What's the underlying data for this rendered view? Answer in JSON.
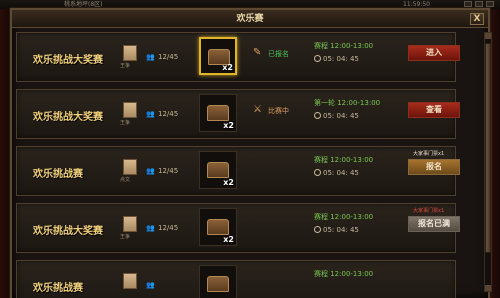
{
  "topbar": {
    "left_text": "桃系地坪(8区)",
    "right_text": "11:59:50"
  },
  "window": {
    "title": "欢乐赛",
    "close_label": "X"
  },
  "events": [
    {
      "name": "欢乐挑战大奖赛",
      "tag": "王争",
      "players": "12/45",
      "reward_qty": "x2",
      "highlighted": true,
      "status": "已报名",
      "time_label": "赛程 12:00-13:00",
      "countdown": "05: 04: 45",
      "note": "",
      "button": "进入",
      "button_style": "red"
    },
    {
      "name": "欢乐挑战大奖赛",
      "tag": "王争",
      "players": "12/45",
      "reward_qty": "x2",
      "highlighted": false,
      "status": "比赛中",
      "time_label": "第一轮 12:00-13:00",
      "countdown": "05: 04: 45",
      "note": "",
      "button": "查看",
      "button_style": "red"
    },
    {
      "name": "欢乐挑战赛",
      "tag": "点文",
      "players": "12/45",
      "reward_qty": "x2",
      "highlighted": false,
      "status": "",
      "time_label": "赛程 12:00-13:00",
      "countdown": "05: 04: 45",
      "note": "大家事门票x1",
      "button": "报名",
      "button_style": "gold"
    },
    {
      "name": "欢乐挑战大奖赛",
      "tag": "王争",
      "players": "12/45",
      "reward_qty": "x2",
      "highlighted": false,
      "status": "",
      "time_label": "赛程 12:00-13:00",
      "countdown": "05: 04: 45",
      "note": "大家事门票x1",
      "button": "报名已满",
      "button_style": "gray"
    },
    {
      "name": "欢乐挑战赛",
      "tag": "",
      "players": "",
      "reward_qty": "",
      "highlighted": false,
      "status": "",
      "time_label": "赛程 12:00-13:00",
      "countdown": "",
      "note": "",
      "button": "",
      "button_style": "red"
    }
  ]
}
